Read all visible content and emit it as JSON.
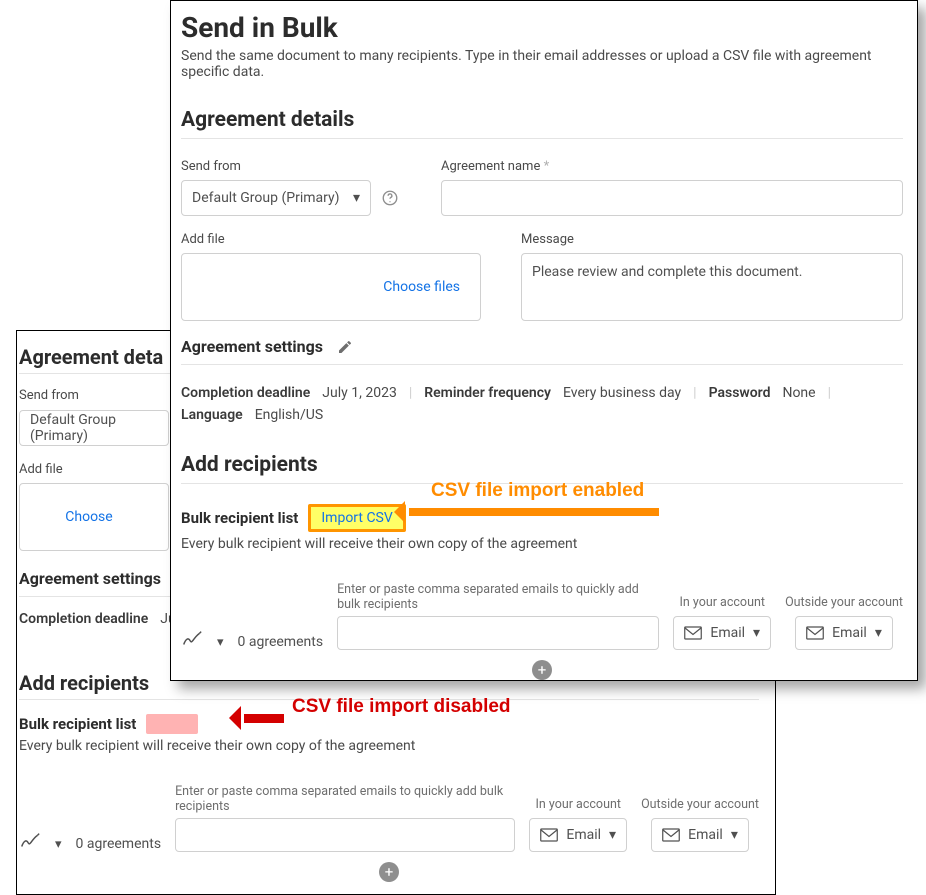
{
  "page": {
    "title": "Send in Bulk",
    "subtitle": "Send the same document to many recipients. Type in their email addresses or upload a CSV file with agreement specific data."
  },
  "agreement_details": {
    "heading": "Agreement details",
    "send_from": {
      "label": "Send from",
      "value": "Default Group (Primary)"
    },
    "agreement_name": {
      "label": "Agreement name",
      "required_mark": "*",
      "value": ""
    },
    "add_file": {
      "label": "Add file",
      "choose_label": "Choose files"
    },
    "message": {
      "label": "Message",
      "value": "Please review and complete this document."
    }
  },
  "agreement_settings": {
    "heading": "Agreement settings",
    "completion_deadline": {
      "label": "Completion deadline",
      "value": "July 1, 2023"
    },
    "reminder_frequency": {
      "label": "Reminder frequency",
      "value": "Every business day"
    },
    "password": {
      "label": "Password",
      "value": "None"
    },
    "language": {
      "label": "Language",
      "value": "English/US"
    }
  },
  "add_recipients": {
    "heading": "Add recipients",
    "bulk_label": "Bulk recipient list",
    "import_label": "Import CSV",
    "description": "Every bulk recipient will receive their own copy of the agreement",
    "agreements_count": "0 agreements",
    "emails_hint": "Enter or paste comma separated emails to quickly add bulk recipients",
    "in_account": {
      "label": "In your account",
      "chip_text": "Email"
    },
    "out_account": {
      "label": "Outside your account",
      "chip_text": "Email"
    }
  },
  "annotations": {
    "enabled": "CSV file import enabled",
    "disabled": "CSV file import disabled"
  },
  "back_panel": {
    "agreement_details_heading": "Agreement deta",
    "send_from": {
      "label": "Send from",
      "value": "Default Group (Primary)"
    },
    "add_file": {
      "label": "Add file",
      "choose_label": "Choose"
    },
    "agreement_settings_heading": "Agreement settings",
    "completion_deadline": {
      "label": "Completion deadline",
      "value": "July"
    }
  }
}
